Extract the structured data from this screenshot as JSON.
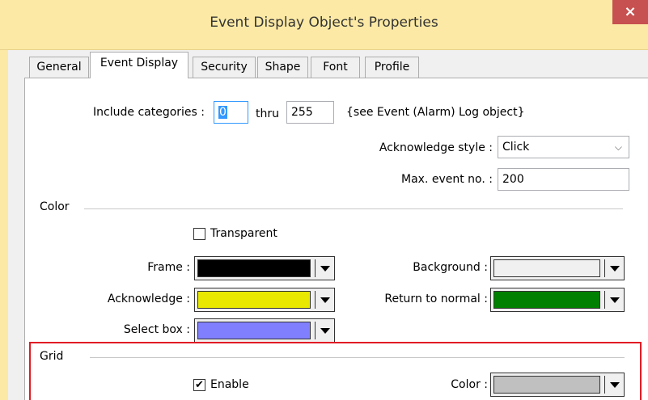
{
  "window": {
    "title": "Event Display Object's Properties",
    "close_glyph": "×"
  },
  "tabs": [
    {
      "label": "General"
    },
    {
      "label": "Event Display"
    },
    {
      "label": "Security"
    },
    {
      "label": "Shape"
    },
    {
      "label": "Font"
    },
    {
      "label": "Profile"
    }
  ],
  "categories": {
    "label": "Include categories :",
    "from_value": "0",
    "thru_label": "thru",
    "to_value": "255",
    "note": "{see Event (Alarm) Log object}"
  },
  "acknowledge": {
    "label": "Acknowledge style :",
    "value": "Click"
  },
  "max_event": {
    "label": "Max. event no. :",
    "value": "200"
  },
  "color_group": {
    "title": "Color",
    "transparent_label": "Transparent",
    "transparent_checked": false,
    "frame": {
      "label": "Frame :",
      "color": "#000000"
    },
    "background": {
      "label": "Background :",
      "color": "#f0f0f0"
    },
    "acknowledge": {
      "label": "Acknowledge :",
      "color": "#e8e800"
    },
    "return_to_normal": {
      "label": "Return to normal :",
      "color": "#008000"
    },
    "select_box": {
      "label": "Select box :",
      "color": "#8080ff"
    }
  },
  "grid_group": {
    "title": "Grid",
    "enable_label": "Enable",
    "enable_checked": true,
    "color_label": "Color :",
    "color": "#c0c0c0"
  },
  "colors": {
    "titlebar": "#fbe9a5",
    "close": "#c75050",
    "highlight": "#e01c24",
    "focus": "#3399ff"
  }
}
